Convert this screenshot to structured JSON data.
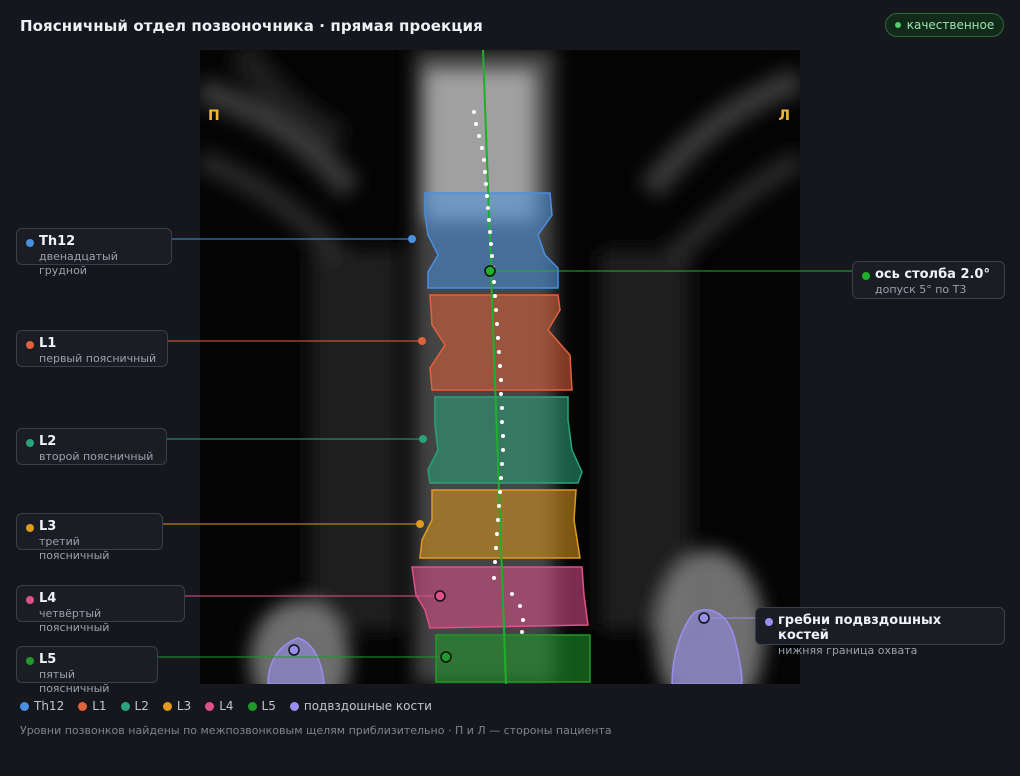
{
  "title": "Поясничный отдел позвоночника · прямая проекция",
  "badge": {
    "label": "качественное",
    "color": "#4fd16a"
  },
  "viewer": {
    "side_right": "П",
    "side_left": "Л"
  },
  "callouts": {
    "th12": {
      "name": "Th12",
      "sub": "двенадцатый грудной",
      "color": "#4a8fe0"
    },
    "l1": {
      "name": "L1",
      "sub": "первый поясничный",
      "color": "#e0623a"
    },
    "l2": {
      "name": "L2",
      "sub": "второй поясничный",
      "color": "#2aa37a"
    },
    "l3": {
      "name": "L3",
      "sub": "третий поясничный",
      "color": "#e09a1e"
    },
    "l4": {
      "name": "L4",
      "sub": "четвёртый поясничный",
      "color": "#e0508a"
    },
    "l5": {
      "name": "L5",
      "sub": "пятый поясничный",
      "color": "#1f9a2a"
    },
    "axis": {
      "name": "ось столба 2.0°",
      "sub": "допуск 5° по Т3",
      "color": "#1fb02a"
    },
    "iliac": {
      "name": "гребни подвздошных костей",
      "sub": "нижняя граница охвата",
      "color": "#9a8ef0"
    }
  },
  "legend": [
    {
      "label": "Th12",
      "color": "#4a8fe0"
    },
    {
      "label": "L1",
      "color": "#e0623a"
    },
    {
      "label": "L2",
      "color": "#2aa37a"
    },
    {
      "label": "L3",
      "color": "#e09a1e"
    },
    {
      "label": "L4",
      "color": "#e0508a"
    },
    {
      "label": "L5",
      "color": "#1f9a2a"
    },
    {
      "label": "подвздошные кости",
      "color": "#9a8ef0"
    }
  ],
  "footnote": "Уровни позвонков найдены по межпозвонковым щелям приблизительно · П и Л — стороны пациента"
}
